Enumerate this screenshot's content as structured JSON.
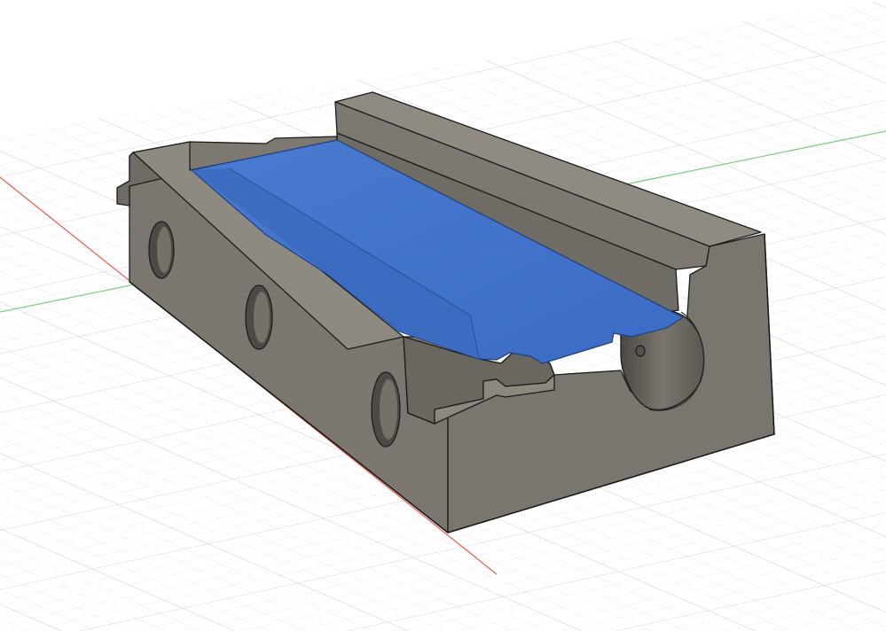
{
  "viewport": {
    "view": "3D perspective",
    "background_color": "#ffffff",
    "ground_grid": true,
    "grid_minor_color": "#e6e6e6",
    "grid_major_color": "#cfcfcf",
    "axis_x_color": "#e8645a",
    "axis_y_color": "#4fbf5c"
  },
  "model": {
    "body_color": "#827e77",
    "top_face_color": "#8c8880",
    "side_face_color": "#6b6862",
    "edge_color": "#1c1c1c",
    "selected_face_color": "#3b6bc4",
    "selected_face_highlight": "#4a7bd0",
    "through_holes": 3,
    "pin_holes": 1
  }
}
